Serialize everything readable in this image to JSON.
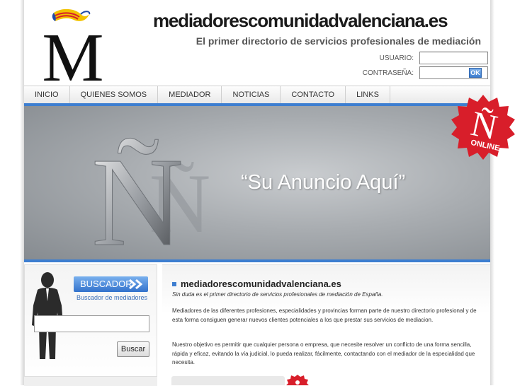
{
  "header": {
    "site_title": "mediadorescomunidadvalenciana.es",
    "tagline": "El primer directorio de servicios profesionales de mediación",
    "logo_letter": "M",
    "login": {
      "user_label": "USUARIO:",
      "password_label": "CONTRASEÑA:",
      "user_value": "",
      "password_value": "",
      "ok_label": "OK"
    }
  },
  "nav": {
    "items": [
      {
        "label": "INICIO"
      },
      {
        "label": "QUIENES SOMOS"
      },
      {
        "label": "MEDIADOR"
      },
      {
        "label": "NOTICIAS"
      },
      {
        "label": "CONTACTO"
      },
      {
        "label": "LINKS"
      }
    ]
  },
  "banner": {
    "headline": "“Su Anuncio Aquí”",
    "logo_letter": "Ñ",
    "badge_letter": "Ñ",
    "badge_text": "ONLINE"
  },
  "sidebar": {
    "search_button": "BUSCADOR",
    "search_subtitle": "Buscador de mediadores",
    "search_value": "",
    "buscar_button": "Buscar"
  },
  "content": {
    "title": "mediadorescomunidadvalenciana.es",
    "subtitle": "Sin duda es el primer directorio de servicios profesionales de mediación de España.",
    "paragraph1": "Mediadores de las diferentes profesiones, especialidades y provincias forman parte de nuestro directorio profesional y de esta forma consiguen generar nuevos clientes potenciales a los que prestar sus servicios de mediacion.",
    "paragraph2": "Nuestro objetivo es permitir que cualquier persona o empresa, que necesite resolver un conflicto de una forma sencilla, rápida y eficaz, evitando la vía judicial, lo pueda realizar, fácilmente, contactando con el mediador de la especialidad que necesita."
  },
  "colors": {
    "accent": "#3d7ed0",
    "badge_red": "#d81e2a",
    "banner_gray": "#a9adb1"
  }
}
